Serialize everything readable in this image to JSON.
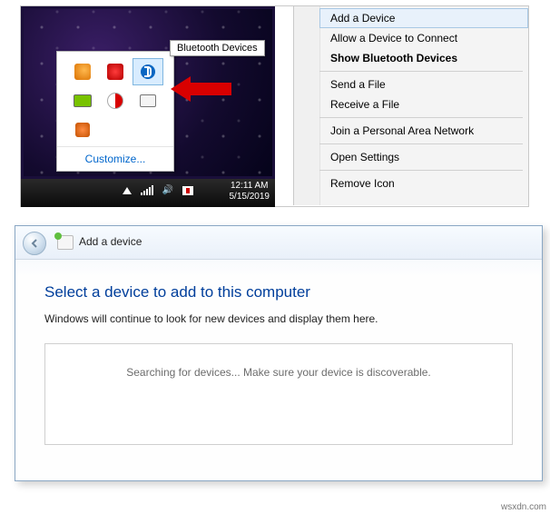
{
  "tray_popup": {
    "tooltip": "Bluetooth Devices",
    "customize": "Customize...",
    "icons": [
      "fox-icon",
      "airtel-icon",
      "bluetooth-icon",
      "battery-icon",
      "ccleaner-icon",
      "screen-icon",
      "orange-app-icon"
    ]
  },
  "taskbar": {
    "time": "12:11 AM",
    "date": "5/15/2019"
  },
  "context_menu": {
    "items": [
      {
        "label": "Add a Device",
        "highlighted": true
      },
      {
        "label": "Allow a Device to Connect"
      },
      {
        "label": "Show Bluetooth Devices",
        "bold": true
      },
      {
        "sep": true
      },
      {
        "label": "Send a File"
      },
      {
        "label": "Receive a File"
      },
      {
        "sep": true
      },
      {
        "label": "Join a Personal Area Network"
      },
      {
        "sep": true
      },
      {
        "label": "Open Settings"
      },
      {
        "sep": true
      },
      {
        "label": "Remove Icon"
      }
    ]
  },
  "window": {
    "title": "Add a device",
    "heading": "Select a device to add to this computer",
    "subtext": "Windows will continue to look for new devices and display them here.",
    "searching": "Searching for devices...  Make sure your device is discoverable."
  },
  "watermark": "wsxdn.com"
}
